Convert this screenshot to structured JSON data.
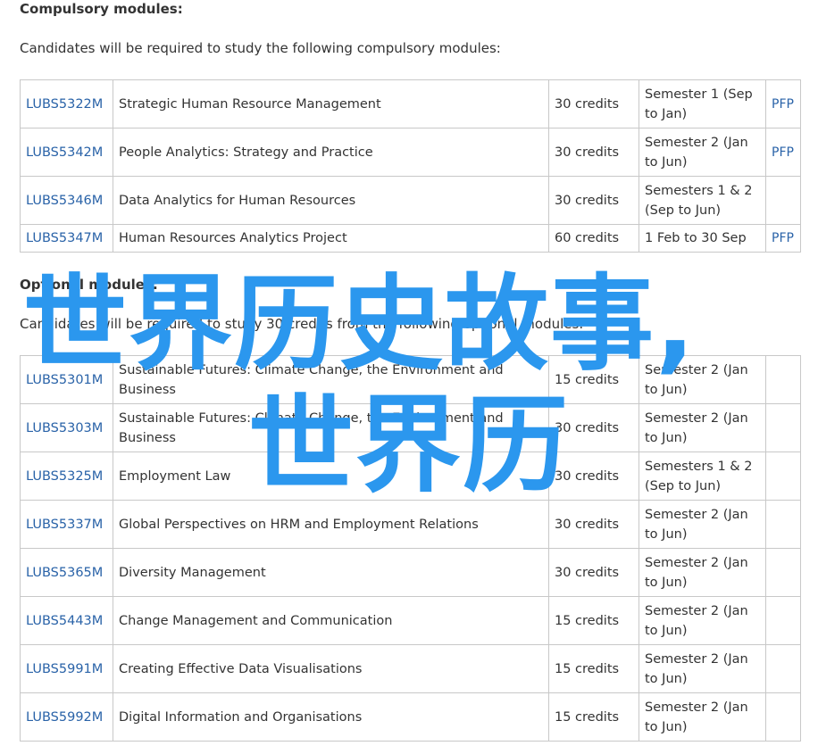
{
  "compulsory": {
    "heading": "Compulsory modules:",
    "intro": "Candidates will be required to study the following compulsory modules:",
    "rows": [
      {
        "code": "LUBS5322M",
        "title": "Strategic Human Resource Management",
        "credits": "30 credits",
        "semester": "Semester 1 (Sep to Jan)",
        "pfp": "PFP"
      },
      {
        "code": "LUBS5342M",
        "title": "People Analytics: Strategy and Practice",
        "credits": "30 credits",
        "semester": "Semester 2 (Jan to Jun)",
        "pfp": "PFP"
      },
      {
        "code": "LUBS5346M",
        "title": "Data Analytics for Human Resources",
        "credits": "30 credits",
        "semester": "Semesters 1 & 2 (Sep to Jun)",
        "pfp": ""
      },
      {
        "code": "LUBS5347M",
        "title": "Human Resources Analytics Project",
        "credits": "60 credits",
        "semester": "1 Feb to 30 Sep",
        "pfp": "PFP"
      }
    ]
  },
  "optional": {
    "heading": "Optional modules:",
    "intro": "Candidates will be required to study 30 credits from the following optional modules:",
    "rows": [
      {
        "code": "LUBS5301M",
        "title": "Sustainable Futures: Climate Change, the Environment and Business",
        "credits": "15 credits",
        "semester": "Semester 2 (Jan to Jun)",
        "pfp": ""
      },
      {
        "code": "LUBS5303M",
        "title": "Sustainable Futures: Climate Change, the Environment and Business",
        "credits": "30 credits",
        "semester": "Semester 2 (Jan to Jun)",
        "pfp": ""
      },
      {
        "code": "LUBS5325M",
        "title": "Employment Law",
        "credits": "30 credits",
        "semester": "Semesters 1 & 2 (Sep to Jun)",
        "pfp": ""
      },
      {
        "code": "LUBS5337M",
        "title": "Global Perspectives on HRM and Employment Relations",
        "credits": "30 credits",
        "semester": "Semester 2 (Jan to Jun)",
        "pfp": ""
      },
      {
        "code": "LUBS5365M",
        "title": "Diversity Management",
        "credits": "30 credits",
        "semester": "Semester 2 (Jan to Jun)",
        "pfp": ""
      },
      {
        "code": "LUBS5443M",
        "title": "Change Management and Communication",
        "credits": "15 credits",
        "semester": "Semester 2 (Jan to Jun)",
        "pfp": ""
      },
      {
        "code": "LUBS5991M",
        "title": "Creating Effective Data Visualisations",
        "credits": "15 credits",
        "semester": "Semester 2 (Jan to Jun)",
        "pfp": ""
      },
      {
        "code": "LUBS5992M",
        "title": "Digital Information and Organisations",
        "credits": "15 credits",
        "semester": "Semester 2 (Jan to Jun)",
        "pfp": ""
      }
    ]
  },
  "overlay": {
    "line1": "世界历史故事,",
    "line2": "世界历",
    "color": "#2b97ee"
  },
  "colors": {
    "link": "#2a63a8",
    "border": "#c8c8c8",
    "text": "#333333"
  }
}
